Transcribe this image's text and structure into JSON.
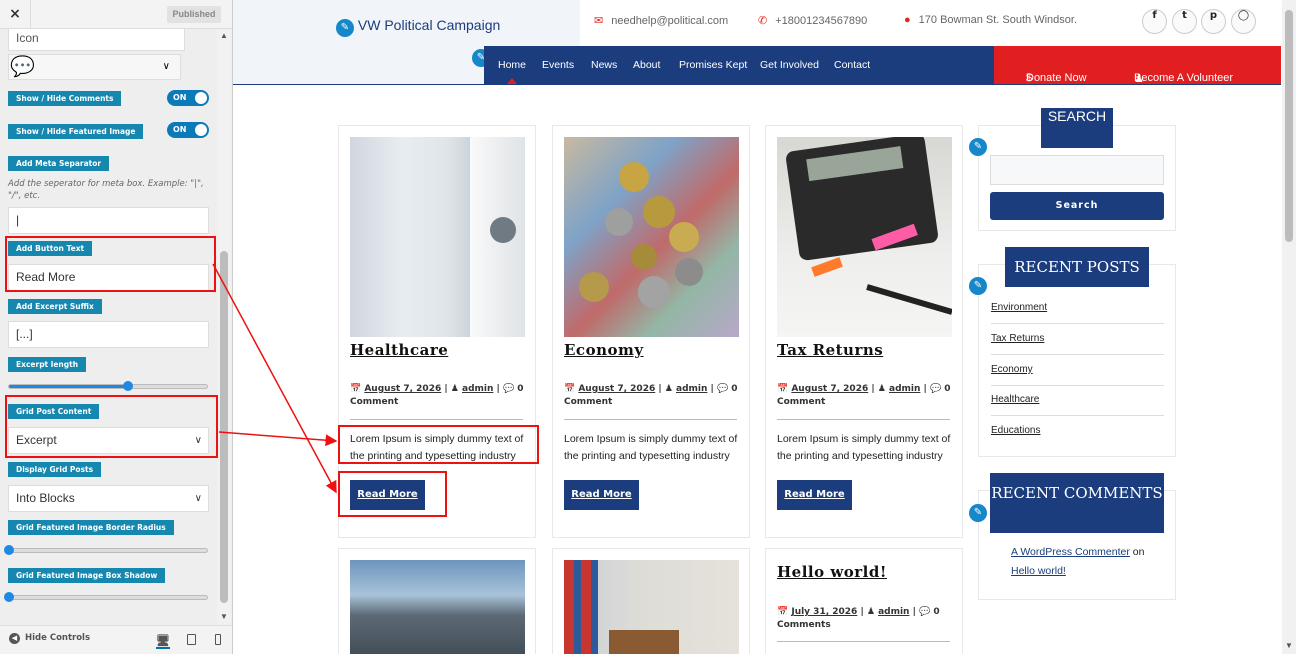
{
  "panel": {
    "close_icon": "×",
    "published_label": "Published",
    "icon_field_label": "Icon",
    "show_comments_label": "Show / Hide Comments",
    "show_comments_value": "ON",
    "show_featured_label": "Show / Hide Featured Image",
    "show_featured_value": "ON",
    "meta_sep_label": "Add Meta Separator",
    "meta_sep_help": "Add the seperator for meta box. Example: \"|\", \"/\", etc.",
    "meta_sep_value": "|",
    "button_text_label": "Add Button Text",
    "button_text_value": "Read More",
    "excerpt_suffix_label": "Add Excerpt Suffix",
    "excerpt_suffix_value": "[...]",
    "excerpt_length_label": "Excerpt length",
    "excerpt_length_fraction": 0.6,
    "grid_content_label": "Grid Post Content",
    "grid_content_value": "Excerpt",
    "display_grid_label": "Display Grid Posts",
    "display_grid_value": "Into Blocks",
    "border_radius_label": "Grid Featured Image Border Radius",
    "border_radius_fraction": 0,
    "box_shadow_label": "Grid Featured Image Box Shadow",
    "box_shadow_fraction": 0,
    "hide_controls_label": "Hide Controls"
  },
  "site": {
    "logo_text": "VW Political Campaign",
    "email": "needhelp@political.com",
    "phone": "+18001234567890",
    "address": "170 Bowman St. South Windsor.",
    "social_icons": [
      "facebook-icon",
      "twitter-icon",
      "pinterest-icon",
      "instagram-icon"
    ],
    "nav": [
      "Home",
      "Events",
      "News",
      "About",
      "Promises Kept",
      "Get Involved",
      "Contact"
    ],
    "donate_label": "Donate Now",
    "volunteer_label": "Become A Volunteer",
    "colors": {
      "brand_navy": "#1b3c7d",
      "brand_red": "#e21f20",
      "accent_blue": "#1688b0"
    }
  },
  "posts": [
    {
      "title": "Healthcare",
      "date": "August 7, 2026",
      "author": "admin",
      "comments": "0 Comment",
      "excerpt": "Lorem Ipsum is simply dummy text of the printing and typesetting industry",
      "button": "Read More"
    },
    {
      "title": "Economy",
      "date": "August 7, 2026",
      "author": "admin",
      "comments": "0 Comment",
      "excerpt": "Lorem Ipsum is simply dummy text of the printing and typesetting industry",
      "button": "Read More"
    },
    {
      "title": "Tax Returns",
      "date": "August 7, 2026",
      "author": "admin",
      "comments": "0 Comment",
      "excerpt": "Lorem Ipsum is simply dummy text of the printing and typesetting industry",
      "button": "Read More"
    },
    {
      "title": "Hello world!",
      "date": "July 31, 2026",
      "author": "admin",
      "comments": "0 Comments"
    }
  ],
  "sidebar": {
    "search_title": "SEARCH",
    "search_button": "Search",
    "recent_posts_title": "RECENT POSTS",
    "recent_posts": [
      "Environment",
      "Tax Returns",
      "Economy",
      "Healthcare",
      "Educations"
    ],
    "recent_comments_title": "RECENT COMMENTS",
    "comment_author": "A WordPress Commenter",
    "comment_on": "on",
    "comment_post": "Hello world!"
  }
}
